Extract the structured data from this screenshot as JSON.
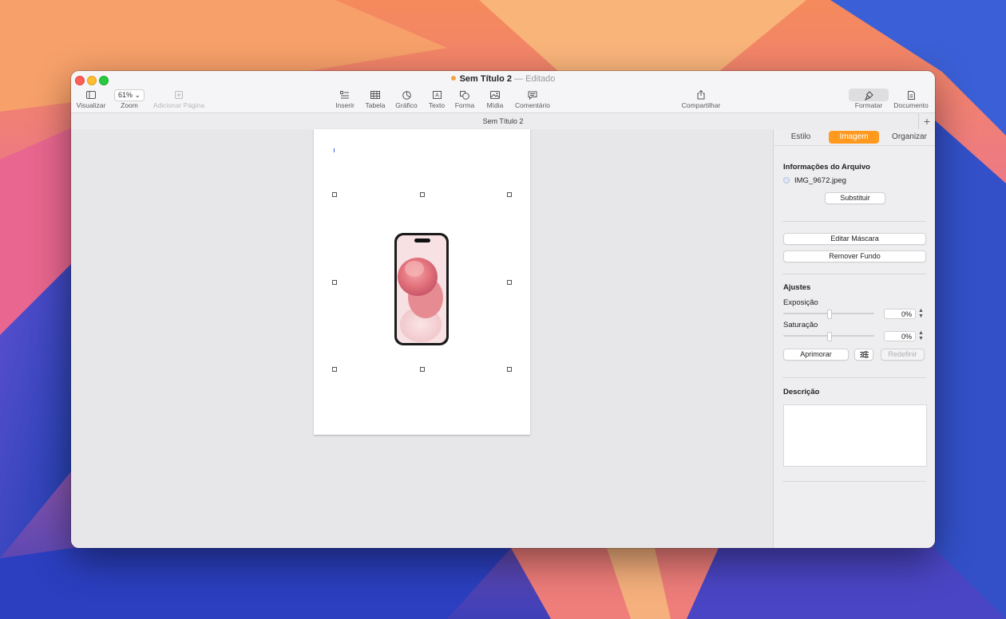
{
  "window": {
    "title": "Sem Título 2",
    "separator": "—",
    "state": "Editado",
    "document_tab": "Sem Título 2",
    "add_tab": "+"
  },
  "toolbar": {
    "view_label": "Visualizar",
    "zoom_value": "61%",
    "zoom_label": "Zoom",
    "add_page_label": "Adicionar Página",
    "insert_label": "Inserir",
    "table_label": "Tabela",
    "chart_label": "Gráfico",
    "text_label": "Texto",
    "shape_label": "Forma",
    "media_label": "Mídia",
    "comment_label": "Comentário",
    "share_label": "Compartilhar",
    "format_label": "Formatar",
    "document_label": "Documento"
  },
  "inspector": {
    "tabs": [
      {
        "label": "Estilo",
        "active": false
      },
      {
        "label": "Imagem",
        "active": true
      },
      {
        "label": "Organizar",
        "active": false
      }
    ],
    "file_info_title": "Informações do Arquivo",
    "file_name": "IMG_9672.jpeg",
    "replace_button": "Substituir",
    "edit_mask_button": "Editar Máscara",
    "remove_bg_button": "Remover Fundo",
    "adjustments_title": "Ajustes",
    "exposure_label": "Exposição",
    "exposure_value": "0%",
    "saturation_label": "Saturação",
    "saturation_value": "0%",
    "enhance_button": "Aprimorar",
    "reset_button": "Redefinir",
    "description_title": "Descrição"
  },
  "colors": {
    "accent": "#ff9a1f",
    "close": "#fe5f57",
    "minimize": "#febc2e",
    "maximize": "#28c840"
  }
}
